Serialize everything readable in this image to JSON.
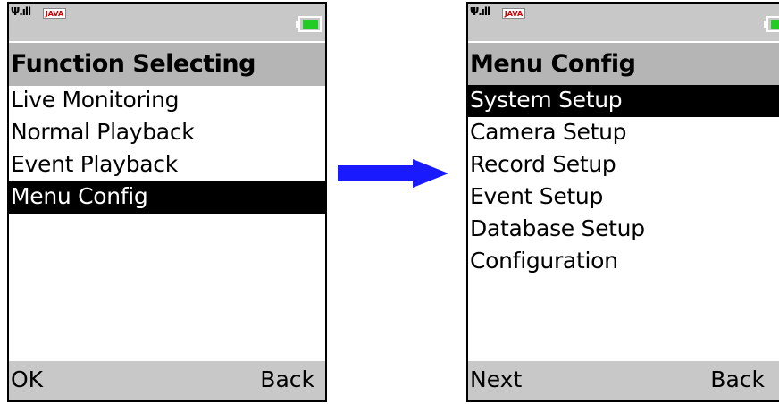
{
  "left_phone": {
    "status": {
      "signal_icon": "signal-icon",
      "java_label": "JAVA",
      "battery_icon": "battery-icon"
    },
    "title": "Function Selecting",
    "menu_items": [
      "Live Monitoring",
      "Normal Playback",
      "Event Playback",
      "Menu Config"
    ],
    "selected_index": 3,
    "softkeys": {
      "left": "OK",
      "right": "Back"
    }
  },
  "right_phone": {
    "status": {
      "signal_icon": "signal-icon",
      "java_label": "JAVA",
      "battery_icon": "battery-icon"
    },
    "title": "Menu Config",
    "menu_items": [
      "System Setup",
      "Camera Setup",
      "Record Setup",
      "Event Setup",
      "Database Setup",
      "Configuration"
    ],
    "selected_index": 0,
    "softkeys": {
      "left": "Next",
      "right": "Back"
    }
  },
  "colors": {
    "bar_gray": "#c8c8c8",
    "title_gray": "#b5b5b5",
    "selection": "#000000",
    "arrow": "#1a1aff",
    "battery_fill": "#22cc22",
    "java_text": "#d00000"
  },
  "arrow_icon": "right-arrow-icon"
}
